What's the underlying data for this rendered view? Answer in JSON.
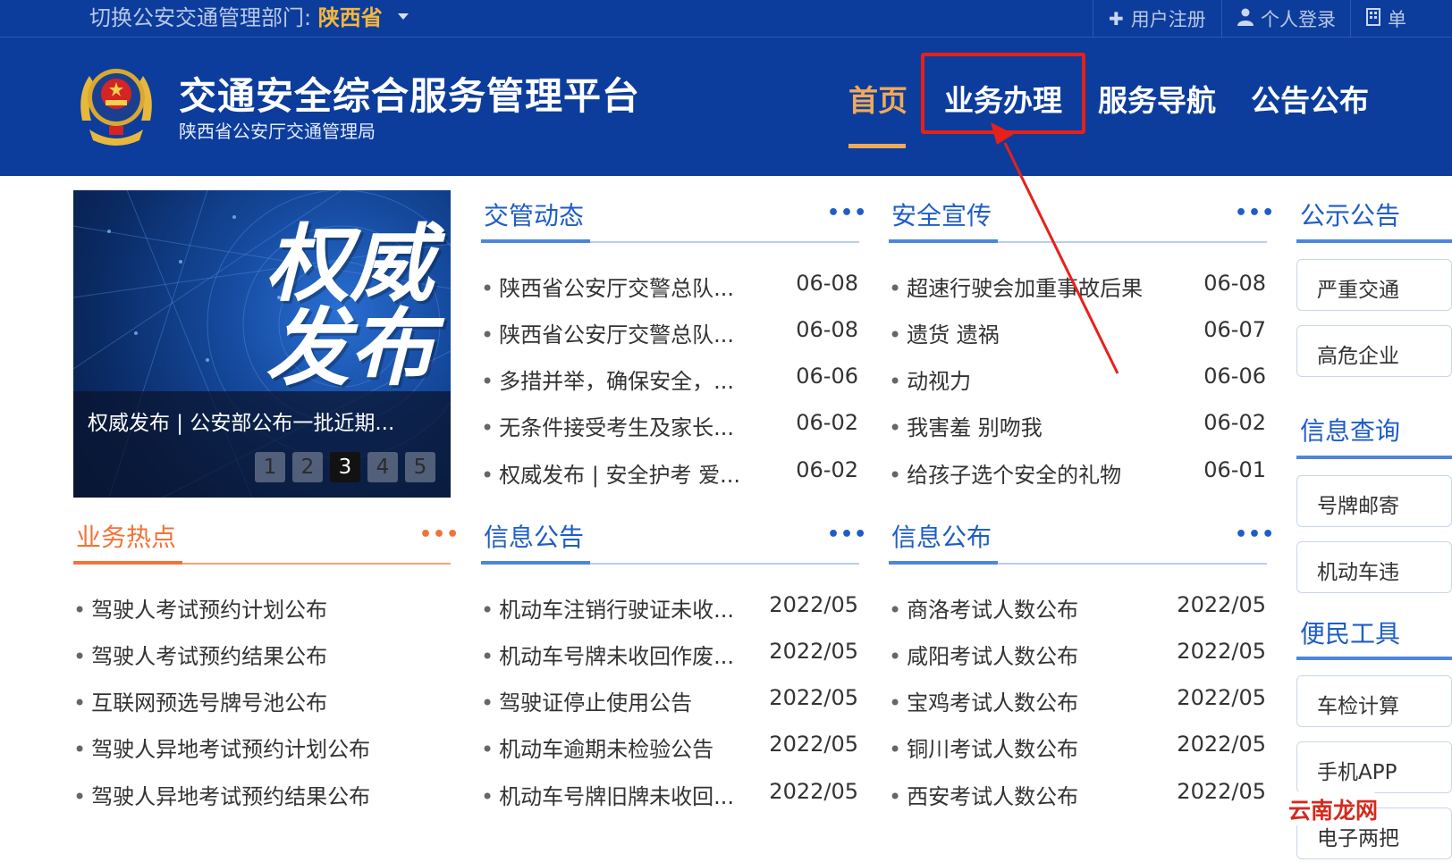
{
  "topbar": {
    "switch_label": "切换公安交通管理部门:",
    "province": "陕西省",
    "register": "用户注册",
    "login": "个人登录",
    "unit_login": "单"
  },
  "header": {
    "title": "交通安全综合服务管理平台",
    "subtitle": "陕西省公安厅交通管理局",
    "nav": [
      "首页",
      "业务办理",
      "服务导航",
      "公告公布"
    ]
  },
  "banner": {
    "big_line1": "权威",
    "big_line2": "发布",
    "caption": "权威发布 | 公安部公布一批近期...",
    "pages": [
      "1",
      "2",
      "3",
      "4",
      "5"
    ],
    "active_page": "3"
  },
  "more": "•••",
  "sections": {
    "traffic_news": {
      "title": "交管动态",
      "items": [
        {
          "text": "陕西省公安厅交警总队...",
          "date": "06-08"
        },
        {
          "text": "陕西省公安厅交警总队...",
          "date": "06-08"
        },
        {
          "text": "多措并举，确保安全，...",
          "date": "06-06"
        },
        {
          "text": "无条件接受考生及家长...",
          "date": "06-02"
        },
        {
          "text": "权威发布 | 安全护考 爱...",
          "date": "06-02"
        }
      ]
    },
    "safety_promo": {
      "title": "安全宣传",
      "items": [
        {
          "text": "超速行驶会加重事故后果",
          "date": "06-08"
        },
        {
          "text": "遗货 遗祸",
          "date": "06-07"
        },
        {
          "text": "动视力",
          "date": "06-06"
        },
        {
          "text": "我害羞 别吻我",
          "date": "06-02"
        },
        {
          "text": "给孩子选个安全的礼物",
          "date": "06-01"
        }
      ]
    },
    "hot_business": {
      "title": "业务热点",
      "items": [
        {
          "text": "驾驶人考试预约计划公布"
        },
        {
          "text": "驾驶人考试预约结果公布"
        },
        {
          "text": "互联网预选号牌号池公布"
        },
        {
          "text": "驾驶人异地考试预约计划公布"
        },
        {
          "text": "驾驶人异地考试预约结果公布"
        }
      ]
    },
    "info_notice": {
      "title": "信息公告",
      "items": [
        {
          "text": "机动车注销行驶证未收...",
          "date": "2022/05"
        },
        {
          "text": "机动车号牌未收回作废...",
          "date": "2022/05"
        },
        {
          "text": "驾驶证停止使用公告",
          "date": "2022/05"
        },
        {
          "text": "机动车逾期未检验公告",
          "date": "2022/05"
        },
        {
          "text": "机动车号牌旧牌未收回...",
          "date": "2022/05"
        }
      ]
    },
    "info_publish": {
      "title": "信息公布",
      "items": [
        {
          "text": "商洛考试人数公布",
          "date": "2022/05"
        },
        {
          "text": "咸阳考试人数公布",
          "date": "2022/05"
        },
        {
          "text": "宝鸡考试人数公布",
          "date": "2022/05"
        },
        {
          "text": "铜川考试人数公布",
          "date": "2022/05"
        },
        {
          "text": "西安考试人数公布",
          "date": "2022/05"
        }
      ]
    }
  },
  "sidebar": {
    "public_notice": {
      "title": "公示公告",
      "items": [
        "严重交通",
        "高危企业"
      ]
    },
    "info_query": {
      "title": "信息查询",
      "items": [
        "号牌邮寄",
        "机动车违"
      ]
    },
    "tools": {
      "title": "便民工具",
      "items": [
        "车检计算",
        "手机APP",
        "电子两把"
      ]
    }
  },
  "watermark": "云南龙网",
  "colors": {
    "header_blue": "#0c3d9c",
    "accent_orange": "#f0a95a",
    "section_blue": "#1e5dc7",
    "hot_orange": "#f2733a",
    "annotation_red": "#e8201a"
  }
}
